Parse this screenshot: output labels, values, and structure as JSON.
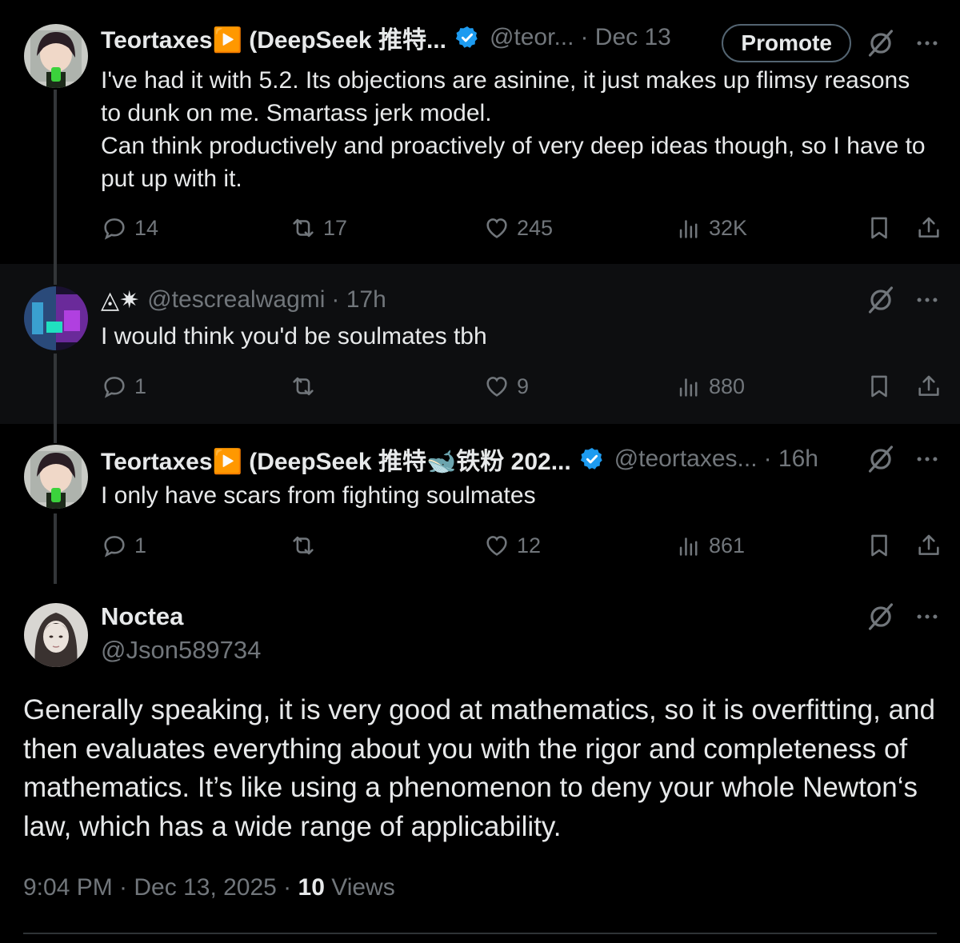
{
  "tweets": [
    {
      "display_name": "Teortaxes▶️ (DeepSeek 推特...",
      "handle": "@teor...",
      "time": "· Dec 13",
      "promote_label": "Promote",
      "text": "I've had it with 5.2. Its objections are asinine, it just makes up flimsy reasons to dunk on me. Smartass jerk model.\nCan think productively and proactively of very deep ideas though, so I have to put up with it.",
      "replies": "14",
      "reposts": "17",
      "likes": "245",
      "views": "32K"
    },
    {
      "display_name": "◬✷",
      "handle": "@tescrealwagmi",
      "time": "· 17h",
      "text": "I would think you'd be soulmates tbh",
      "replies": "1",
      "reposts": "",
      "likes": "9",
      "views": "880"
    },
    {
      "display_name": "Teortaxes▶️ (DeepSeek 推特🐋铁粉 202...",
      "handle": "@teortaxes...",
      "time": "· 16h",
      "text": "I only have scars from fighting soulmates",
      "replies": "1",
      "reposts": "",
      "likes": "12",
      "views": "861"
    }
  ],
  "main_tweet": {
    "display_name": "Noctea",
    "handle": "@Json589734",
    "text": "Generally speaking, it is very good at mathematics, so it is overfitting, and then evaluates everything about you with the rigor and completeness of mathematics. It’s like using a phenomenon to deny your whole Newton‘s law, which has a wide range of applicability.",
    "timestamp": "9:04 PM · Dec 13, 2025 · ",
    "views_count": "10",
    "views_label": " Views"
  },
  "colors": {
    "background": "#000000",
    "text": "#e7e9ea",
    "muted": "#71767b",
    "verified": "#1d9bf0"
  },
  "icons": [
    "reply-icon",
    "repost-icon",
    "like-icon",
    "views-icon",
    "bookmark-icon",
    "share-icon",
    "grok-icon",
    "more-icon",
    "verified-icon"
  ]
}
